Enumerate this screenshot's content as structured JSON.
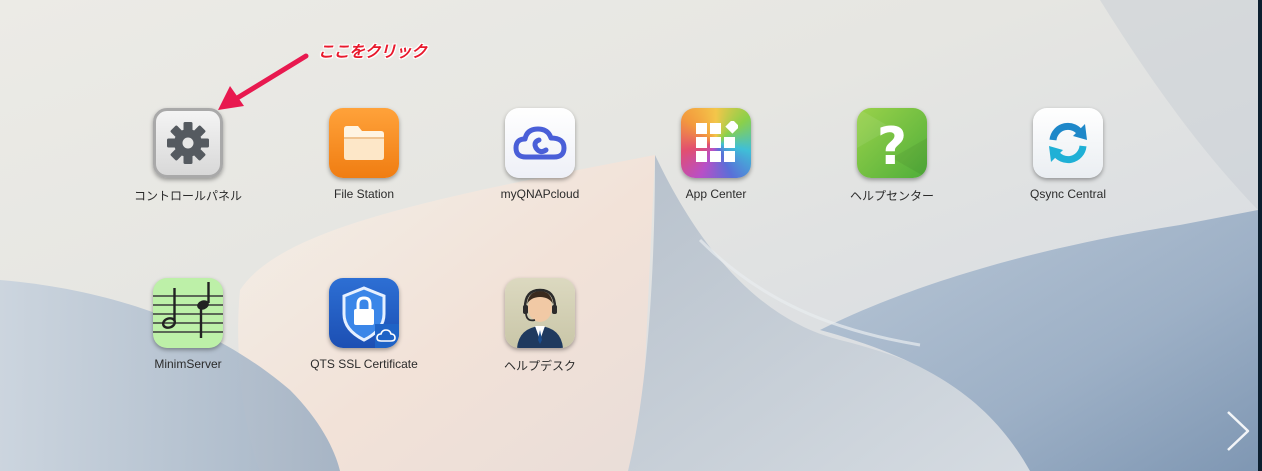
{
  "annotation": {
    "text": "ここをクリック",
    "color": "#e8192c"
  },
  "apps": [
    {
      "label": "コントロールパネル",
      "icon": "gear-icon"
    },
    {
      "label": "File Station",
      "icon": "folder-icon"
    },
    {
      "label": "myQNAPcloud",
      "icon": "cloud-icon"
    },
    {
      "label": "App Center",
      "icon": "app-grid-icon"
    },
    {
      "label": "ヘルプセンター",
      "icon": "question-icon"
    },
    {
      "label": "Qsync Central",
      "icon": "sync-icon"
    },
    {
      "label": "MinimServer",
      "icon": "music-notes-icon"
    },
    {
      "label": "QTS SSL Certificate",
      "icon": "shield-lock-icon"
    },
    {
      "label": "ヘルプデスク",
      "icon": "support-agent-icon"
    }
  ],
  "navigation": {
    "next_icon": "chevron-right-icon"
  }
}
